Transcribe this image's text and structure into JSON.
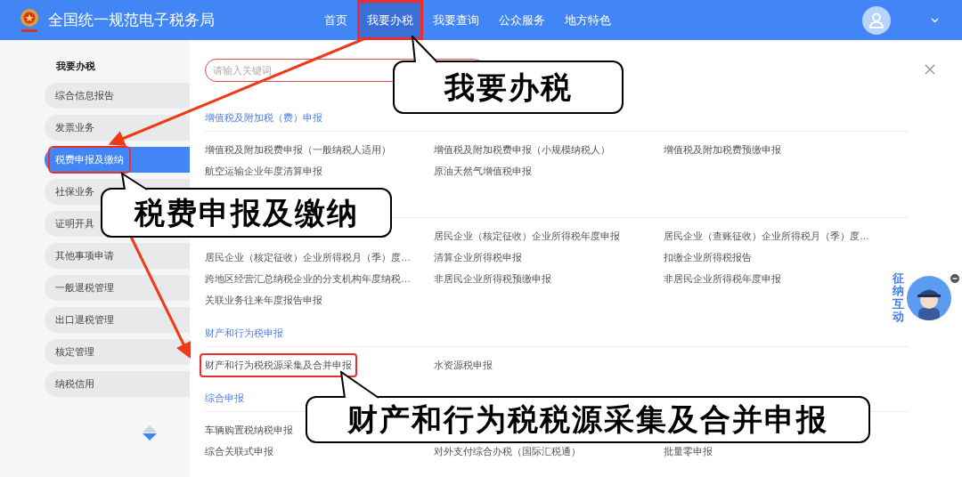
{
  "header": {
    "title": "全国统一规范电子税务局"
  },
  "nav": [
    {
      "label": "首页",
      "selected": false,
      "highlighted": false
    },
    {
      "label": "我要办税",
      "selected": true,
      "highlighted": true
    },
    {
      "label": "我要查询",
      "selected": false,
      "highlighted": false
    },
    {
      "label": "公众服务",
      "selected": false,
      "highlighted": false
    },
    {
      "label": "地方特色",
      "selected": false,
      "highlighted": false
    }
  ],
  "sidebar": {
    "title": "我要办税",
    "items": [
      {
        "label": "综合信息报告",
        "selected": false,
        "highlighted": false
      },
      {
        "label": "发票业务",
        "selected": false,
        "highlighted": false
      },
      {
        "label": "税费申报及缴纳",
        "selected": true,
        "highlighted": true
      },
      {
        "label": "社保业务",
        "selected": false,
        "highlighted": false
      },
      {
        "label": "证明开具",
        "selected": false,
        "highlighted": false
      },
      {
        "label": "其他事项申请",
        "selected": false,
        "highlighted": false
      },
      {
        "label": "一般退税管理",
        "selected": false,
        "highlighted": false
      },
      {
        "label": "出口退税管理",
        "selected": false,
        "highlighted": false
      },
      {
        "label": "核定管理",
        "selected": false,
        "highlighted": false
      },
      {
        "label": "纳税信用",
        "selected": false,
        "highlighted": false
      }
    ]
  },
  "search": {
    "placeholder": "请输入关键词"
  },
  "sections": [
    {
      "heading": "增值税及附加税（费）申报",
      "rows": [
        [
          {
            "text": "增值税及附加税费申报（一般纳税人适用）",
            "highlighted": false
          },
          {
            "text": "增值税及附加税费申报（小规模纳税人）",
            "highlighted": false
          },
          {
            "text": "增值税及附加税费预缴申报",
            "highlighted": false
          }
        ],
        [
          {
            "text": "航空运输企业年度清算申报",
            "highlighted": false
          },
          {
            "text": "原油天然气增值税申报",
            "highlighted": false
          }
        ]
      ]
    },
    {
      "rows": [
        [
          null,
          {
            "text": "居民企业（核定征收）企业所得税年度申报",
            "highlighted": false
          },
          {
            "text": "居民企业（查账征收）企业所得税月（季）度…",
            "highlighted": false
          }
        ],
        [
          {
            "text": "居民企业（核定征收）企业所得税月（季）度…",
            "highlighted": false
          },
          {
            "text": "清算企业所得税申报",
            "highlighted": false
          },
          {
            "text": "扣缴企业所得税报告",
            "highlighted": false
          }
        ],
        [
          {
            "text": "跨地区经营汇总纳税企业的分支机构年度纳税…",
            "highlighted": false
          },
          {
            "text": "非居民企业所得税预缴申报",
            "highlighted": false
          },
          {
            "text": "非居民企业所得税年度申报",
            "highlighted": false
          }
        ],
        [
          {
            "text": "关联业务往来年度报告申报",
            "highlighted": false
          }
        ]
      ]
    },
    {
      "heading": "财产和行为税申报",
      "rows": [
        [
          {
            "text": "财产和行为税税源采集及合并申报",
            "highlighted": true
          },
          {
            "text": "水资源税申报",
            "highlighted": false
          }
        ]
      ]
    },
    {
      "heading": "综合申报",
      "rows": [
        [
          {
            "text": "车辆购置税纳税申报",
            "highlighted": false
          }
        ],
        [
          {
            "text": "综合关联式申报",
            "highlighted": false
          },
          {
            "text": "对外支付综合办税（国际汇税通）",
            "highlighted": false
          },
          {
            "text": "批量零申报",
            "highlighted": false
          }
        ]
      ]
    }
  ],
  "assistant_widget": {
    "label": "征纳互动"
  },
  "callouts": [
    "我要办税",
    "税费申报及缴纳",
    "财产和行为税税源采集及合并申报"
  ]
}
